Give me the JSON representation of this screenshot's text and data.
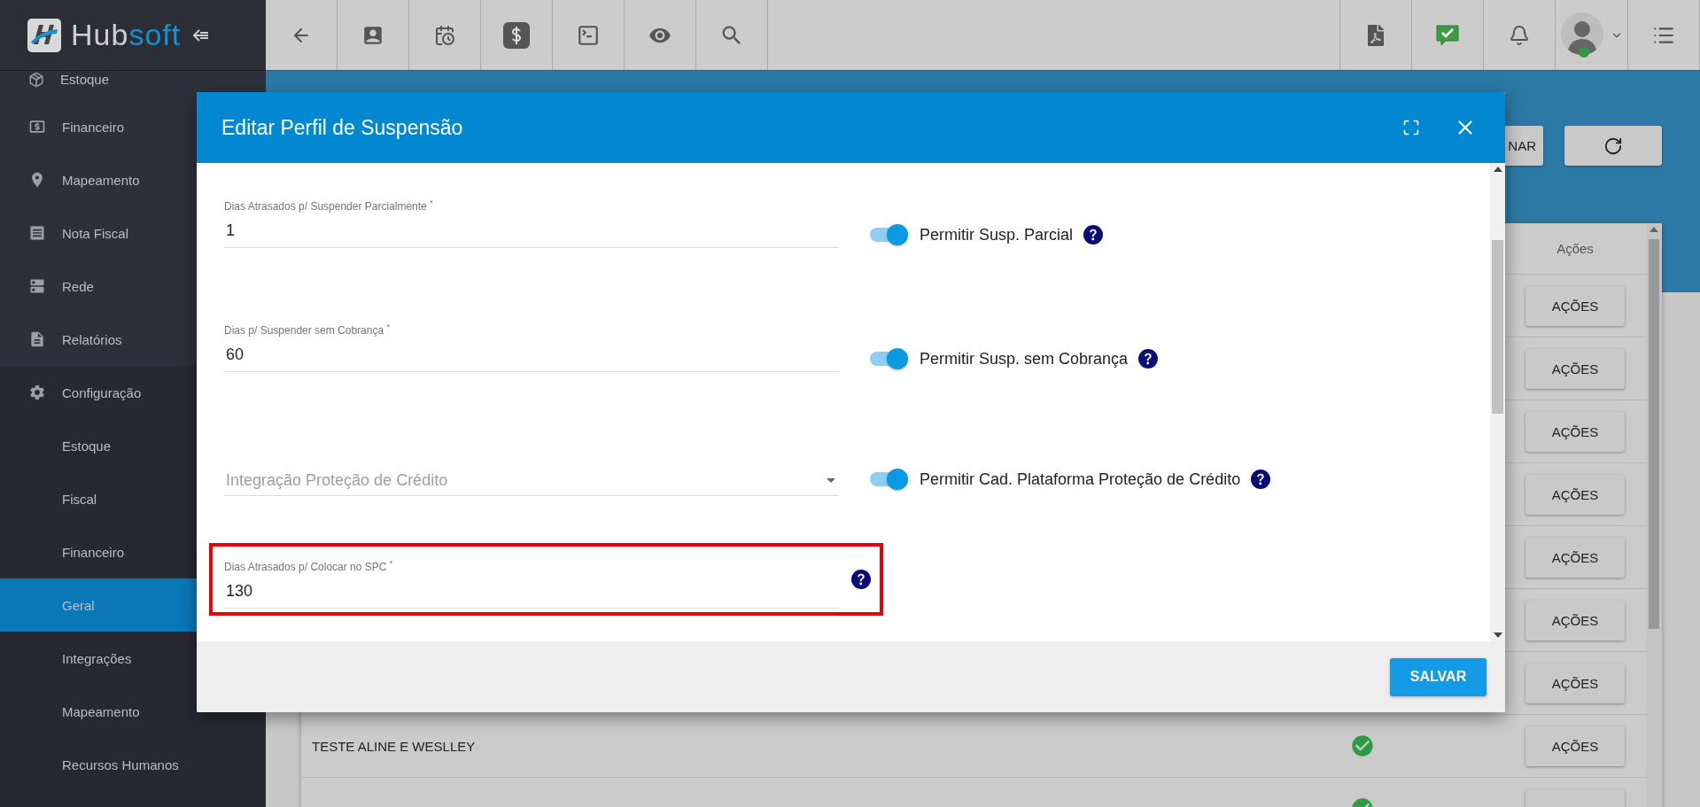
{
  "logo": {
    "part_a": "Hub",
    "part_b": "soft"
  },
  "sidebar": {
    "items": [
      {
        "label": "Estoque",
        "kind": "section",
        "selected": false
      },
      {
        "label": "Financeiro",
        "kind": "section",
        "selected": false
      },
      {
        "label": "Mapeamento",
        "kind": "section",
        "selected": false
      },
      {
        "label": "Nota Fiscal",
        "kind": "section",
        "selected": false
      },
      {
        "label": "Rede",
        "kind": "section",
        "selected": false
      },
      {
        "label": "Relatórios",
        "kind": "section",
        "selected": false
      },
      {
        "label": "Configuração",
        "kind": "section",
        "selected": false,
        "children": [
          {
            "label": "Estoque",
            "selected": false
          },
          {
            "label": "Fiscal",
            "selected": false
          },
          {
            "label": "Financeiro",
            "selected": false
          },
          {
            "label": "Geral",
            "selected": true
          },
          {
            "label": "Integrações",
            "selected": false
          },
          {
            "label": "Mapeamento",
            "selected": false
          },
          {
            "label": "Recursos Humanos",
            "selected": false
          }
        ]
      }
    ]
  },
  "toolbar": {
    "partial_button": "NAR"
  },
  "table": {
    "columns": [
      "Ações"
    ],
    "rows": [
      {
        "action": "AÇÕES"
      },
      {
        "action": "AÇÕES"
      },
      {
        "action": "AÇÕES"
      },
      {
        "action": "AÇÕES"
      },
      {
        "action": "AÇÕES"
      },
      {
        "action": "AÇÕES"
      },
      {
        "action": "AÇÕES"
      },
      {
        "name": "TESTE ALINE E WESLLEY",
        "status_ok": true,
        "action": "AÇÕES"
      },
      {
        "status_ok": true
      }
    ]
  },
  "dialog": {
    "title": "Editar Perfil de Suspensão",
    "fields": [
      {
        "kind": "text",
        "label": "Dias Atrasados p/ Suspender Parcialmente $^{*}$",
        "value": "1",
        "toggle": {
          "label": "Permitir Susp. Parcial",
          "on": true
        }
      },
      {
        "kind": "text",
        "label": "Dias p/ Suspender sem Cobrança $^{*}$",
        "value": "60",
        "toggle": {
          "label": "Permitir Susp. sem Cobrança",
          "on": true
        }
      },
      {
        "kind": "select",
        "placeholder": "Integração Proteção de Crédito",
        "toggle": {
          "label": "Permitir Cad. Plataforma Proteção de Crédito",
          "on": true
        }
      },
      {
        "kind": "text",
        "label": "Dias Atrasados p/ Colocar no SPC $^{*}$",
        "value": "130",
        "highlighted": true,
        "help": true
      }
    ],
    "save_button": "SALVAR"
  }
}
